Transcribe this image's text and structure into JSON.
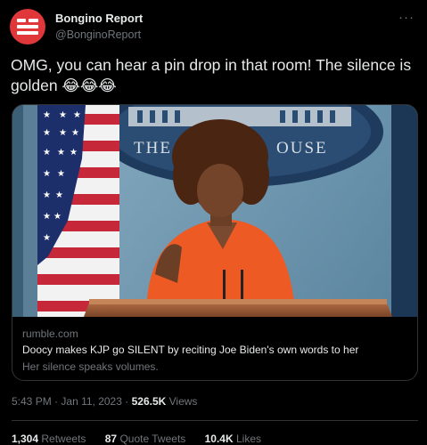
{
  "author": {
    "name": "Bongino Report",
    "handle": "@BonginoReport",
    "avatar_color": "#e0373a"
  },
  "more_icon": "more-options-icon",
  "tweet": {
    "text": "OMG, you can hear a pin drop in that room! The silence is golden 😂😂😂"
  },
  "card": {
    "image_description_icon": "press-briefing-video-thumbnail",
    "domain": "rumble.com",
    "title": "Doocy makes KJP go SILENT by reciting Joe Biden's own words to her",
    "description": "Her silence speaks volumes."
  },
  "meta": {
    "time": "5:43 PM",
    "separator": "·",
    "date": "Jan 11, 2023",
    "views_count": "526.5K",
    "views_label": "Views"
  },
  "stats": {
    "retweets_count": "1,304",
    "retweets_label": "Retweets",
    "quotes_count": "87",
    "quotes_label": "Quote Tweets",
    "likes_count": "10.4K",
    "likes_label": "Likes"
  },
  "colors": {
    "background": "#000000",
    "text_primary": "#e7e9ea",
    "text_secondary": "#71767b",
    "border": "#2f3336"
  }
}
